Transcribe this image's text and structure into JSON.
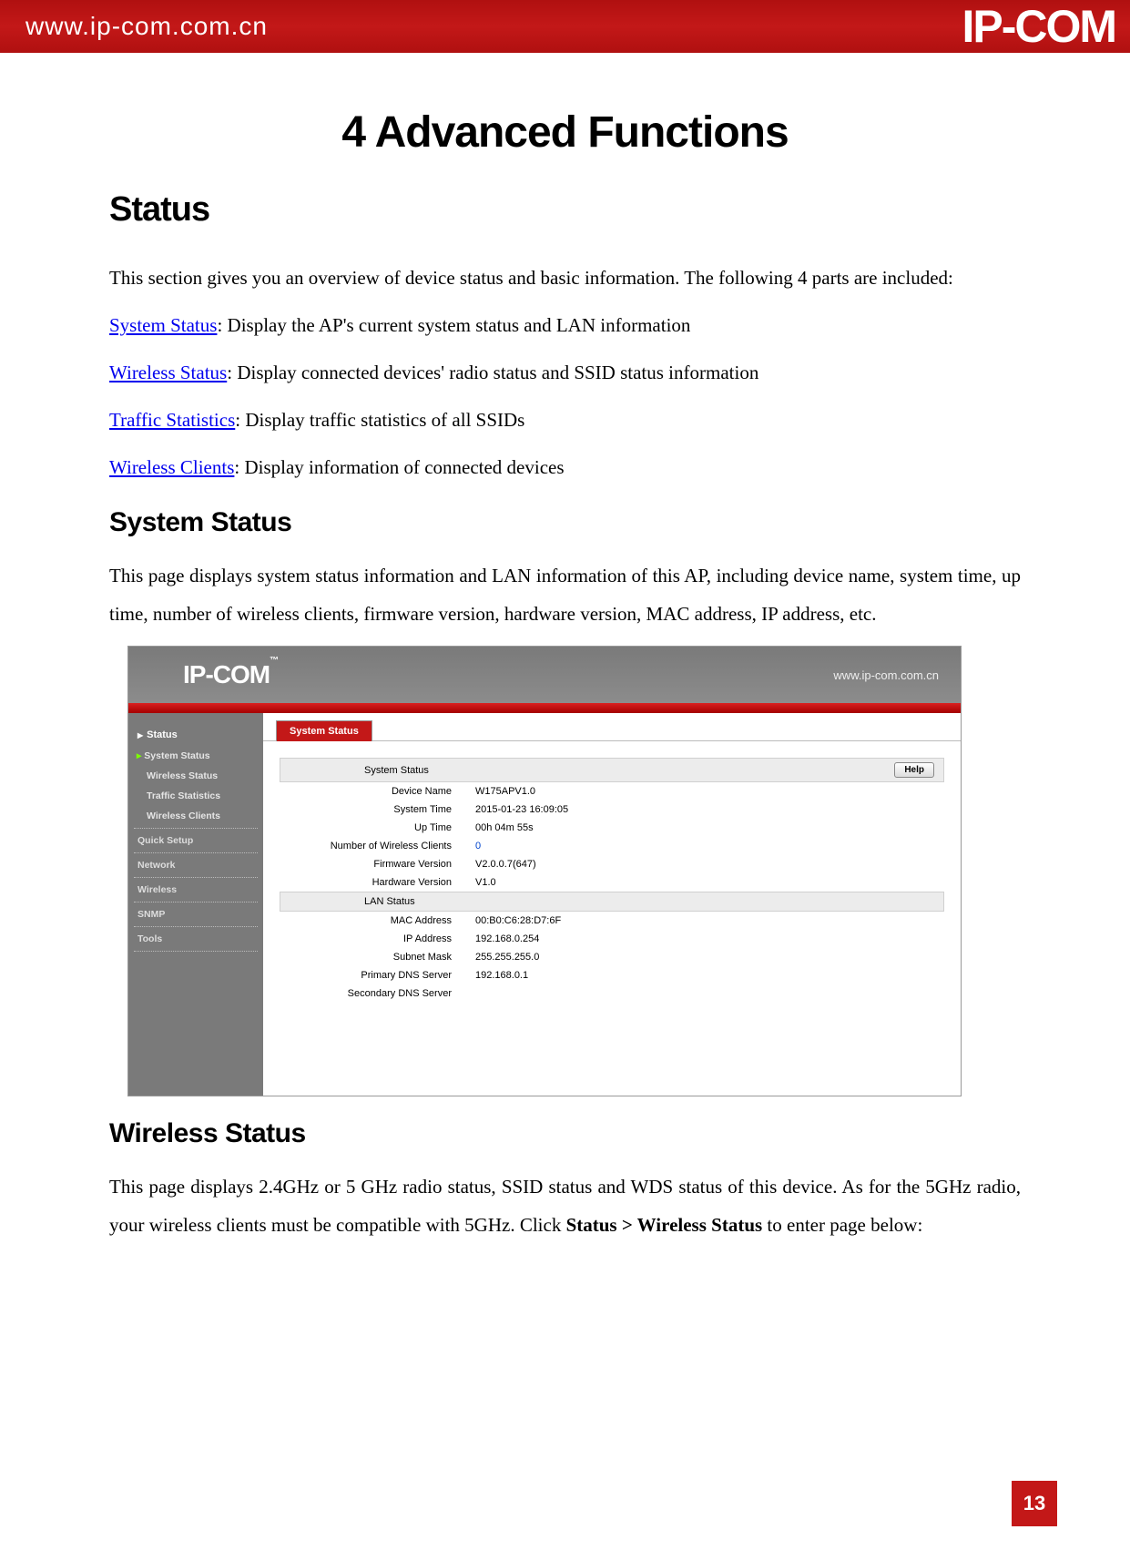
{
  "banner": {
    "url": "www.ip-com.com.cn",
    "logo": "IP-COM"
  },
  "doc": {
    "title": "4 Advanced Functions",
    "h2_status": "Status",
    "intro": "This section gives you an overview of device status and basic information. The following 4 parts are included:",
    "links": {
      "system_status": "System Status",
      "system_status_desc": ": Display the AP's current system status and LAN information",
      "wireless_status": "Wireless Status",
      "wireless_status_desc": ": Display connected devices' radio status and SSID status information",
      "traffic_statistics": "Traffic Statistics",
      "traffic_statistics_desc": ": Display traffic statistics of all SSIDs",
      "wireless_clients": "Wireless Clients",
      "wireless_clients_desc": ": Display information of connected devices"
    },
    "h3_system_status": "System Status",
    "system_status_para": "This page displays system status information and LAN information of this AP, including device name, system time, up time, number of wireless clients, firmware version, hardware version, MAC address, IP address, etc.",
    "h3_wireless_status": "Wireless Status",
    "wireless_status_para_a": "This page displays 2.4GHz or 5 GHz radio status, SSID status and WDS status of this device. As for the 5GHz radio, your wireless clients must be compatible with 5GHz. Click ",
    "wireless_status_para_bold": "Status > Wireless Status",
    "wireless_status_para_b": " to enter page below:"
  },
  "ap": {
    "logo": "IP-COM",
    "top_url": "www.ip-com.com.cn",
    "sidebar": {
      "status": "Status",
      "system_status": "System Status",
      "wireless_status": "Wireless Status",
      "traffic_statistics": "Traffic Statistics",
      "wireless_clients": "Wireless Clients",
      "quick_setup": "Quick Setup",
      "network": "Network",
      "wireless": "Wireless",
      "snmp": "SNMP",
      "tools": "Tools"
    },
    "tab": "System Status",
    "section1": "System Status",
    "section2": "LAN Status",
    "help": "Help",
    "rows": {
      "device_name_l": "Device Name",
      "device_name_v": "W175APV1.0",
      "system_time_l": "System Time",
      "system_time_v": "2015-01-23 16:09:05",
      "up_time_l": "Up Time",
      "up_time_v": "00h 04m 55s",
      "clients_l": "Number of Wireless Clients",
      "clients_v": "0",
      "fw_l": "Firmware Version",
      "fw_v": "V2.0.0.7(647)",
      "hw_l": "Hardware Version",
      "hw_v": "V1.0",
      "mac_l": "MAC Address",
      "mac_v": "00:B0:C6:28:D7:6F",
      "ip_l": "IP Address",
      "ip_v": "192.168.0.254",
      "mask_l": "Subnet Mask",
      "mask_v": "255.255.255.0",
      "pdns_l": "Primary DNS Server",
      "pdns_v": "192.168.0.1",
      "sdns_l": "Secondary DNS Server",
      "sdns_v": ""
    }
  },
  "page_number": "13"
}
